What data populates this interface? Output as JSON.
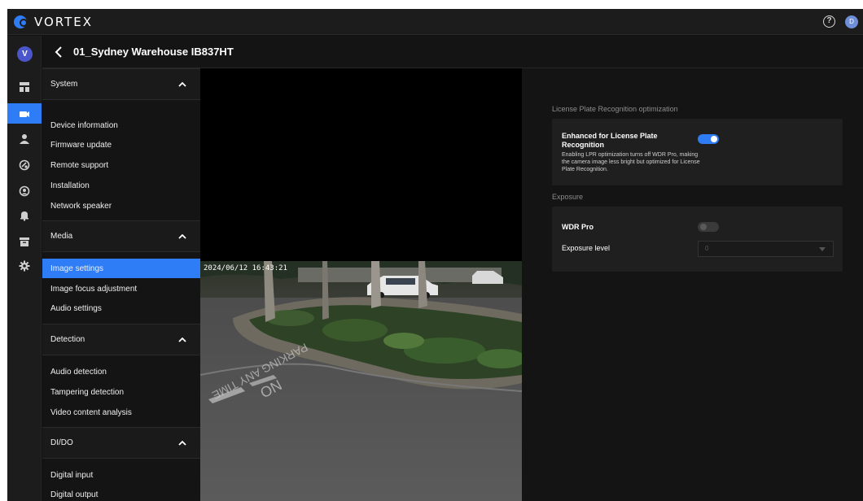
{
  "app": {
    "brand": "VORTEX",
    "user_initial": "D",
    "rail_avatar": "V",
    "accent": "#2f7df6"
  },
  "header": {
    "help_icon": "?",
    "title": "01_Sydney Warehouse IB837HT"
  },
  "rail": {
    "items": [
      {
        "icon": "dashboard-icon",
        "active": false
      },
      {
        "icon": "camera-icon",
        "active": true
      },
      {
        "icon": "user-icon",
        "active": false
      },
      {
        "icon": "integration-icon",
        "active": false
      },
      {
        "icon": "face-icon",
        "active": false
      },
      {
        "icon": "bell-icon",
        "active": false
      },
      {
        "icon": "archive-icon",
        "active": false
      },
      {
        "icon": "gear-icon",
        "active": false
      }
    ]
  },
  "menu": {
    "sections": [
      {
        "label": "System",
        "items": [
          "Device information",
          "Firmware update",
          "Remote support",
          "Installation",
          "Network speaker"
        ]
      },
      {
        "label": "Media",
        "items": [
          "Image settings",
          "Image focus adjustment",
          "Audio settings"
        ]
      },
      {
        "label": "Detection",
        "items": [
          "Audio detection",
          "Tampering detection",
          "Video content analysis"
        ]
      },
      {
        "label": "DI/DO",
        "items": [
          "Digital input",
          "Digital output"
        ]
      }
    ],
    "active_item": "Image settings"
  },
  "viewer": {
    "timestamp": "2024/06/12 16:43:21",
    "road_text_1": "NO",
    "road_text_2": "PARKING ANY TIME"
  },
  "panel": {
    "lpr_section": "License Plate Recognition optimization",
    "lpr_title": "Enhanced for License Plate Recognition",
    "lpr_description": "Enabling LPR optimization turns off WDR Pro, making the camera image less bright but optimized for License Plate Recognition.",
    "lpr_enabled": true,
    "exposure_section": "Exposure",
    "wdr_label": "WDR Pro",
    "wdr_enabled": false,
    "exposure_label": "Exposure level",
    "exposure_value": "0"
  }
}
